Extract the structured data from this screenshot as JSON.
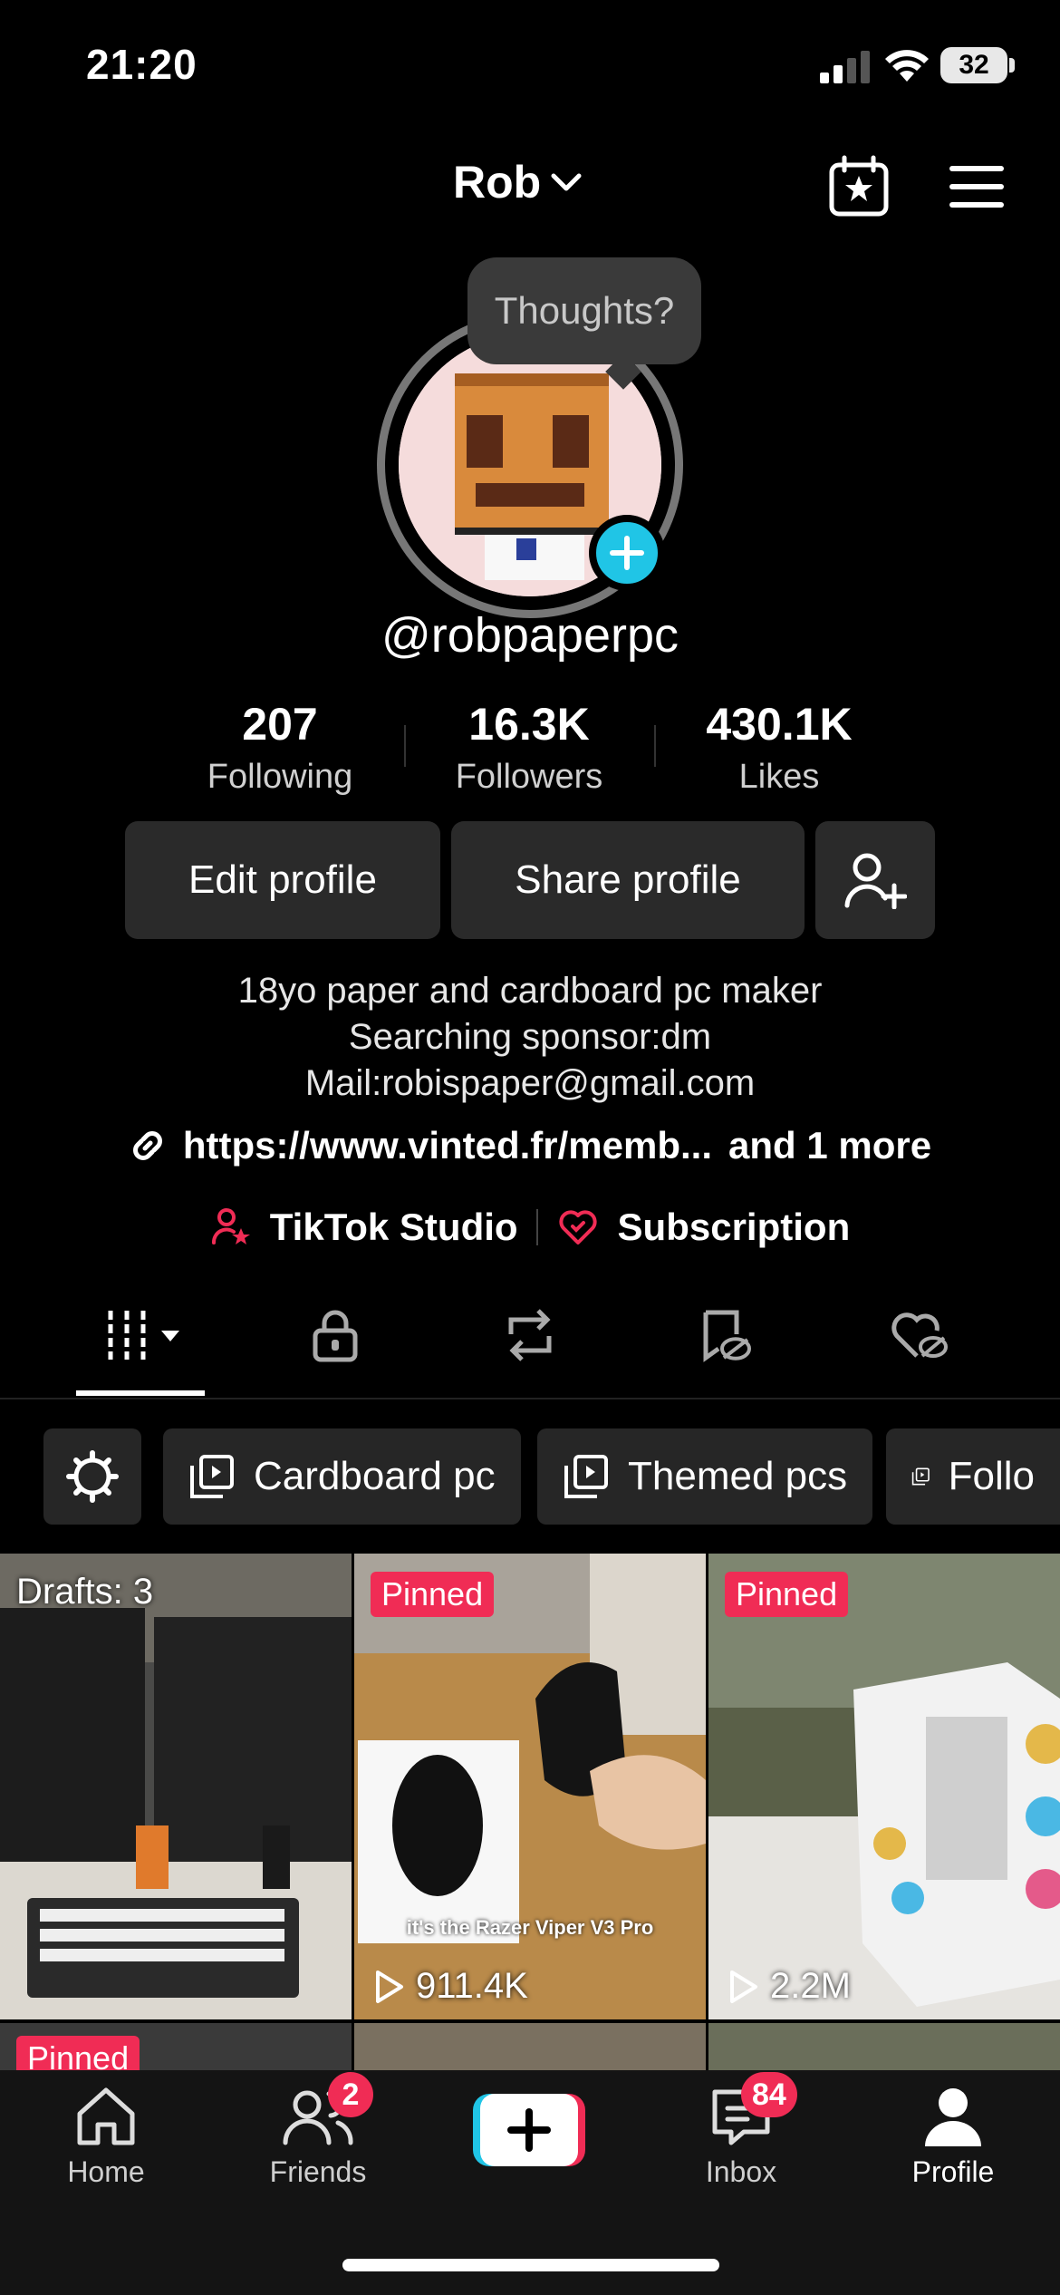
{
  "status_bar": {
    "time": "21:20",
    "battery": "32"
  },
  "header": {
    "username": "Rob"
  },
  "avatar": {
    "bubble_text": "Thoughts?"
  },
  "profile": {
    "handle": "@robpaperpc"
  },
  "stats": [
    {
      "value": "207",
      "label": "Following"
    },
    {
      "value": "16.3K",
      "label": "Followers"
    },
    {
      "value": "430.1K",
      "label": "Likes"
    }
  ],
  "buttons": {
    "edit": "Edit profile",
    "share": "Share profile"
  },
  "bio": {
    "lines": [
      "18yo paper and cardboard pc maker",
      "Searching sponsor:dm",
      "Mail:robispaper@gmail.com"
    ],
    "link": "https://www.vinted.fr/memb...",
    "link_more": "and 1 more"
  },
  "studio_row": {
    "studio": "TikTok Studio",
    "subscription": "Subscription"
  },
  "playlists": [
    "Cardboard pc",
    "Themed pcs",
    "Follo"
  ],
  "videos": [
    {
      "badge": "Drafts: 3",
      "views": "",
      "caption": ""
    },
    {
      "badge": "Pinned",
      "views": "911.4K",
      "caption": "it's the Razer Viper V3 Pro"
    },
    {
      "badge": "Pinned",
      "views": "2.2M",
      "caption": ""
    }
  ],
  "second_row_badge": "Pinned",
  "nav": {
    "home": "Home",
    "friends": "Friends",
    "friends_badge": "2",
    "inbox": "Inbox",
    "inbox_badge": "84",
    "profile": "Profile"
  },
  "colors": {
    "accent_pink": "#f02c55",
    "accent_cyan": "#20c5e6",
    "background": "#000000"
  }
}
